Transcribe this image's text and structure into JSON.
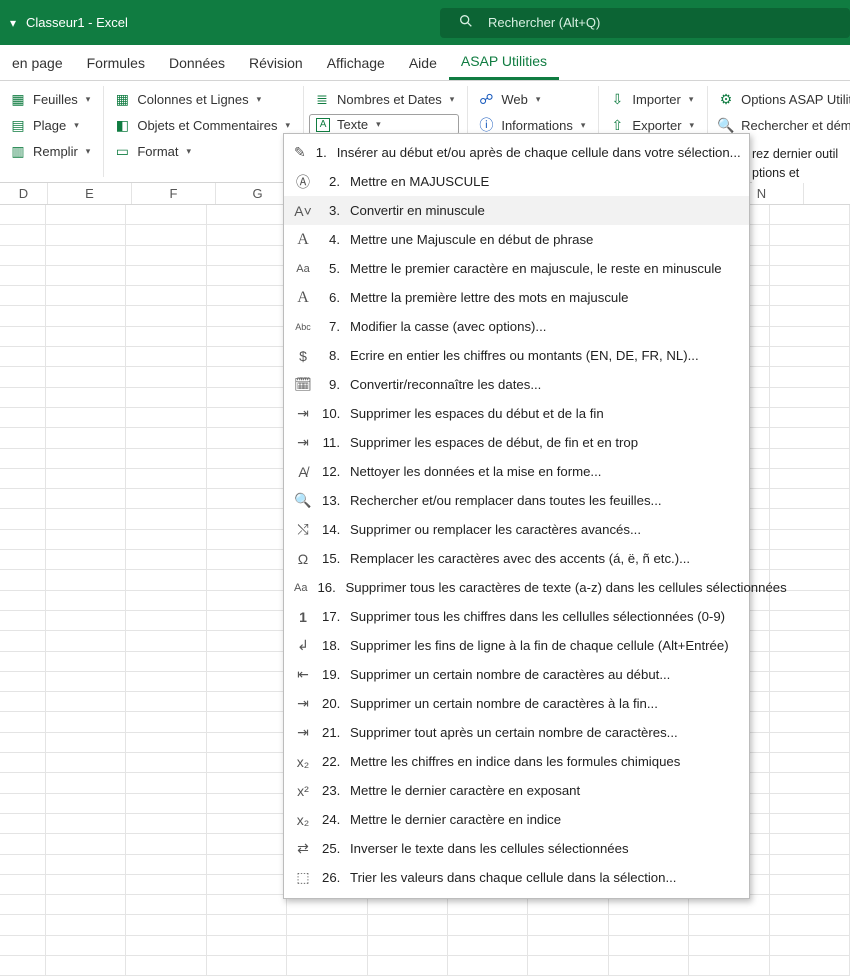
{
  "titlebar": {
    "title": "Classeur1  -  Excel",
    "search_placeholder": "Rechercher (Alt+Q)"
  },
  "tabs": {
    "t1": "en page",
    "t2": "Formules",
    "t3": "Données",
    "t4": "Révision",
    "t5": "Affichage",
    "t6": "Aide",
    "t7": "ASAP Utilities"
  },
  "ribbon": {
    "g1": {
      "feuilles": "Feuilles",
      "plage": "Plage",
      "remplir": "Remplir"
    },
    "g2": {
      "collignes": "Colonnes et Lignes",
      "objcomm": "Objets et Commentaires",
      "format": "Format"
    },
    "g3": {
      "nombres": "Nombres et Dates",
      "texte": "Texte"
    },
    "g4": {
      "web": "Web",
      "info": "Informations"
    },
    "g5": {
      "importer": "Importer",
      "exporter": "Exporter"
    },
    "g6": {
      "options": "Options ASAP Utilities",
      "rechdem": "Rechercher et démarrer un"
    }
  },
  "sidenote": {
    "l1": "rez dernier outil",
    "l2": "ptions et paramètre"
  },
  "menu": {
    "m1": "Insérer au début et/ou après de chaque cellule dans votre sélection...",
    "m2": "Mettre en MAJUSCULE",
    "m3": "Convertir en minuscule",
    "m4": "Mettre une Majuscule en début de phrase",
    "m5": "Mettre le premier caractère en majuscule, le reste en minuscule",
    "m6": "Mettre la première lettre des mots en majuscule",
    "m7": "Modifier la casse (avec options)...",
    "m8": "Ecrire en entier les chiffres ou montants (EN, DE, FR, NL)...",
    "m9": "Convertir/reconnaître les dates...",
    "m10": "Supprimer les espaces du début et de la fin",
    "m11": "Supprimer les espaces de début, de fin et en trop",
    "m12": "Nettoyer les données et la mise en forme...",
    "m13": "Rechercher et/ou remplacer dans toutes les feuilles...",
    "m14": "Supprimer ou remplacer les caractères avancés...",
    "m15": "Remplacer les caractères avec des accents (á, ë, ñ etc.)...",
    "m16": "Supprimer tous les caractères de texte (a-z) dans les cellules sélectionnées",
    "m17": "Supprimer tous les chiffres dans les cellulles sélectionnées (0-9)",
    "m18": "Supprimer les fins de ligne à la fin de chaque cellule (Alt+Entrée)",
    "m19": "Supprimer un certain nombre de caractères au début...",
    "m20": "Supprimer un certain nombre de caractères à la fin...",
    "m21": "Supprimer tout après un certain nombre de caractères...",
    "m22": "Mettre les chiffres en indice dans les formules chimiques",
    "m23": "Mettre le dernier caractère en exposant",
    "m24": "Mettre le dernier caractère en indice",
    "m25": "Inverser le texte dans les cellules sélectionnées",
    "m26": "Trier les valeurs dans chaque cellule dans la sélection...",
    "n1": "1.",
    "n2": "2.",
    "n3": "3.",
    "n4": "4.",
    "n5": "5.",
    "n6": "6.",
    "n7": "7.",
    "n8": "8.",
    "n9": "9.",
    "n10": "10.",
    "n11": "11.",
    "n12": "12.",
    "n13": "13.",
    "n14": "14.",
    "n15": "15.",
    "n16": "16.",
    "n17": "17.",
    "n18": "18.",
    "n19": "19.",
    "n20": "20.",
    "n21": "21.",
    "n22": "22.",
    "n23": "23.",
    "n24": "24.",
    "n25": "25.",
    "n26": "26."
  },
  "cols": {
    "c1": "D",
    "c2": "E",
    "c3": "F",
    "c4": "G",
    "c5": "",
    "c6": "",
    "c7": "",
    "c8": "",
    "c9": "",
    "c10": "N"
  }
}
